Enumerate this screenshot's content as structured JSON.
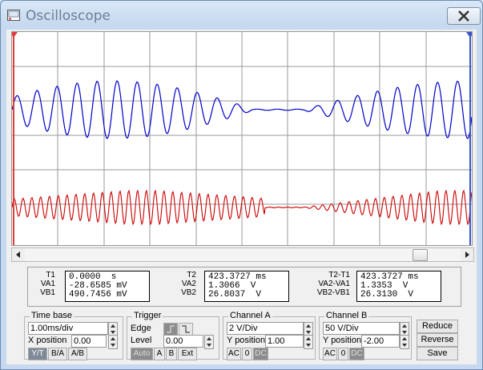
{
  "window": {
    "title": "Oscilloscope"
  },
  "colors": {
    "channel_a": "#0000cc",
    "channel_b": "#cc0000",
    "grid": "#9a9a9a",
    "cursor_1": "#e23c3c",
    "cursor_2": "#3c54c8"
  },
  "readout": {
    "t1": {
      "labels": [
        "T1",
        "VA1",
        "VB1"
      ],
      "values": [
        "0.0000  s",
        "-28.6585 mV",
        "490.7456 mV"
      ]
    },
    "t2": {
      "labels": [
        "T2",
        "VA2",
        "VB2"
      ],
      "values": [
        "423.3727 ms",
        "1.3066  V",
        "26.8037  V"
      ]
    },
    "diff": {
      "labels": [
        "T2-T1",
        "VA2-VA1",
        "VB2-VB1"
      ],
      "values": [
        "423.3727 ms",
        "1.3353  V",
        "26.3130  V"
      ]
    }
  },
  "timebase": {
    "label": "Time base",
    "scale": "1.00ms/div",
    "xpos_label": "X position",
    "xpos": "0.00",
    "modes": [
      "Y/T",
      "B/A",
      "A/B"
    ]
  },
  "trigger": {
    "label": "Trigger",
    "edge_label": "Edge",
    "level_label": "Level",
    "level": "0.00",
    "buttons": [
      "Auto",
      "A",
      "B",
      "Ext"
    ]
  },
  "channel_a": {
    "label": "Channel A",
    "scale": "2  V/Div",
    "ypos_label": "Y position",
    "ypos": "1.00",
    "coupling": [
      "AC",
      "0",
      "DC"
    ]
  },
  "channel_b": {
    "label": "Channel B",
    "scale": "50  V/Div",
    "ypos_label": "Y position",
    "ypos": "-2.00",
    "coupling": [
      "AC",
      "0",
      "DC"
    ]
  },
  "actions": {
    "reduce": "Reduce",
    "reverse": "Reverse",
    "save": "Save"
  }
}
